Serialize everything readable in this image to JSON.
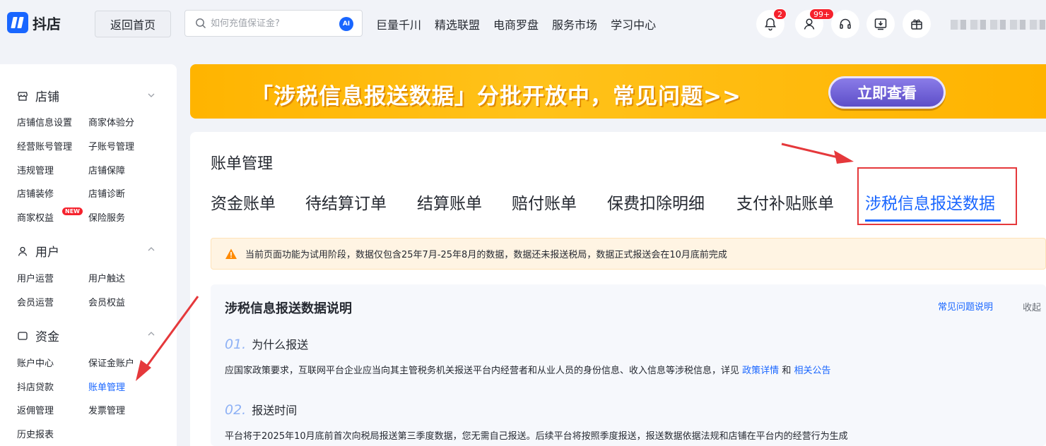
{
  "header": {
    "brand": "抖店",
    "home_button": "返回首页",
    "search_placeholder": "如何充值保证金?",
    "ai_label": "AI",
    "nav": [
      "巨量千川",
      "精选联盟",
      "电商罗盘",
      "服务市场",
      "学习中心"
    ],
    "notify_badge": "2",
    "user_badge": "99+"
  },
  "sidebar": {
    "sections": [
      {
        "title": "店铺",
        "items": [
          "店铺信息设置",
          "商家体验分",
          "经营账号管理",
          "子账号管理",
          "违规管理",
          "店铺保障",
          "店铺装修",
          "店铺诊断",
          "商家权益",
          "保险服务"
        ],
        "new_tag": "NEW"
      },
      {
        "title": "用户",
        "items": [
          "用户运营",
          "用户触达",
          "会员运营",
          "会员权益"
        ]
      },
      {
        "title": "资金",
        "items": [
          "账户中心",
          "保证金账户",
          "抖店贷款",
          "账单管理",
          "返佣管理",
          "发票管理",
          "历史报表"
        ]
      }
    ]
  },
  "banner": {
    "text": "「涉税信息报送数据」分批开放中，常见问题>>",
    "button": "立即查看"
  },
  "main": {
    "title": "账单管理",
    "tabs": [
      "资金账单",
      "待结算订单",
      "结算账单",
      "赔付账单",
      "保费扣除明细",
      "支付补贴账单",
      "涉税信息报送数据"
    ],
    "notice": "当前页面功能为试用阶段，数据仅包含25年7月-25年8月的数据，数据还未报送税局，数据正式报送会在10月底前完成",
    "info": {
      "title": "涉税信息报送数据说明",
      "faq_link": "常见问题说明",
      "collapse": "收起",
      "steps": [
        {
          "num": "01.",
          "title": "为什么报送",
          "text": "应国家政策要求，互联网平台企业应当向其主管税务机关报送平台内经营者和从业人员的身份信息、收入信息等涉税信息，详见",
          "link1": "政策详情",
          "and": "和",
          "link2": "相关公告"
        },
        {
          "num": "02.",
          "title": "报送时间",
          "text": "平台将于2025年10月底前首次向税局报送第三季度数据，您无需自己报送。后续平台将按照季度报送，报送数据依据法规和店铺在平台内的经营行为生成"
        }
      ]
    }
  },
  "colors": {
    "accent": "#1966ff",
    "banner": "#ffb400",
    "annotation": "#e5383b"
  }
}
